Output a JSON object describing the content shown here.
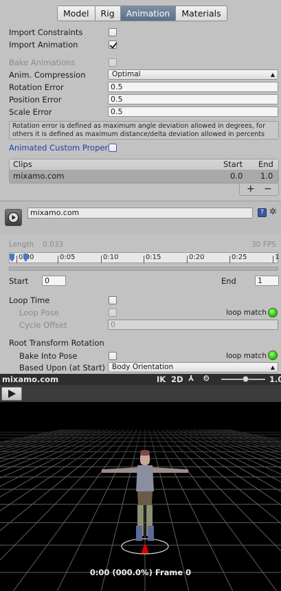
{
  "tabs": [
    {
      "label": "Model",
      "active": false
    },
    {
      "label": "Rig",
      "active": false
    },
    {
      "label": "Animation",
      "active": true
    },
    {
      "label": "Materials",
      "active": false
    }
  ],
  "import_constraints": {
    "label": "Import Constraints",
    "checked": false
  },
  "import_animation": {
    "label": "Import Animation",
    "checked": true
  },
  "bake_animations": {
    "label": "Bake Animations",
    "checked": false,
    "disabled": true
  },
  "anim_compression": {
    "label": "Anim. Compression",
    "value": "Optimal"
  },
  "rotation_error": {
    "label": "Rotation Error",
    "value": "0.5"
  },
  "position_error": {
    "label": "Position Error",
    "value": "0.5"
  },
  "scale_error": {
    "label": "Scale Error",
    "value": "0.5"
  },
  "help_text": {
    "line1": "Rotation error is defined as maximum angle deviation allowed in degrees, for",
    "line2": "others it is defined as maximum distance/delta deviation allowed in percents"
  },
  "animated_custom_properties": {
    "label": "Animated Custom Proper",
    "checked": false
  },
  "clips": {
    "headers": {
      "name": "Clips",
      "start": "Start",
      "end": "End"
    },
    "rows": [
      {
        "name": "mixamo.com",
        "start": "0.0",
        "end": "1.0"
      }
    ],
    "add": "+",
    "remove": "−"
  },
  "clip": {
    "name": "mixamo.com",
    "length_label": "Length",
    "length_value": "0.033",
    "fps": "30 FPS",
    "ticks": [
      "0:00",
      "0:05",
      "0:10",
      "0:15",
      "0:20",
      "0:25",
      "1"
    ],
    "start_label": "Start",
    "start_value": "0",
    "end_label": "End",
    "end_value": "1"
  },
  "loop_time": {
    "label": "Loop Time",
    "checked": false
  },
  "loop_pose": {
    "label": "Loop Pose",
    "checked": false,
    "match": "loop match"
  },
  "cycle_offset": {
    "label": "Cycle Offset",
    "value": "0"
  },
  "root_transform_rotation": {
    "label": "Root Transform Rotation"
  },
  "bake_into_pose": {
    "label": "Bake Into Pose",
    "checked": false,
    "match": "loop match"
  },
  "based_upon": {
    "label": "Based Upon (at Start)",
    "value": "Body Orientation"
  },
  "preview": {
    "title": "mixamo.com",
    "ik": "IK",
    "twod": "2D",
    "speed": "1.0",
    "speed_level": 0.55,
    "status": "0:00 (000.0%) Frame 0"
  },
  "colors": {
    "accent_tab": "#6a7d98",
    "link_blue": "#1f3fa8",
    "match_green": "#2cc412"
  }
}
